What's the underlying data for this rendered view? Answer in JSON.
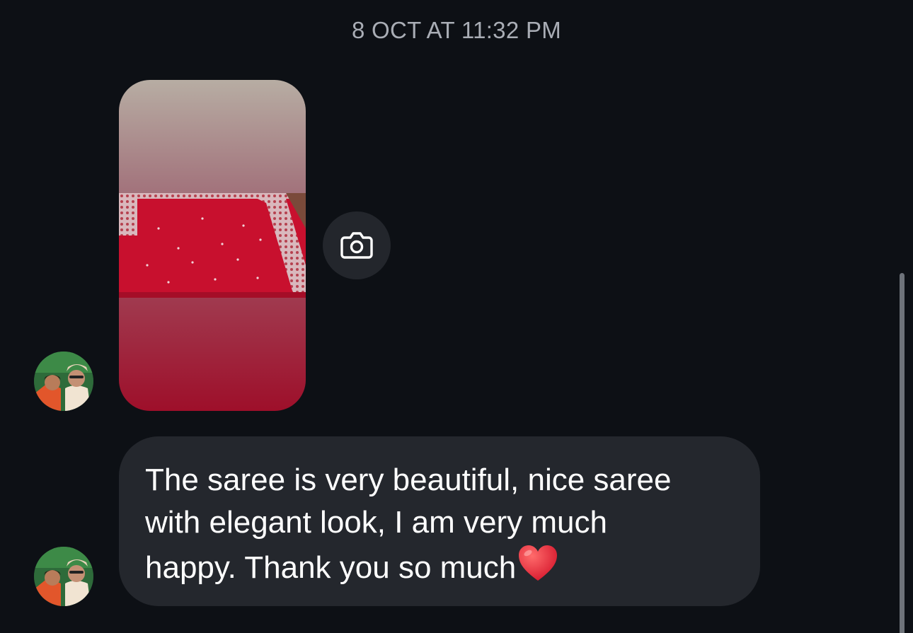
{
  "conversation": {
    "timestamp": "8 OCT AT 11:32 PM",
    "messages": [
      {
        "type": "photo",
        "description_icon": "saree-photo"
      },
      {
        "type": "text",
        "lines": [
          "The saree is very beautiful, nice saree",
          "with elegant look, I am very much",
          "happy. Thank you so much"
        ],
        "emoji": "heart-emoji"
      }
    ]
  },
  "actions": {
    "camera_icon": "camera-icon"
  },
  "colors": {
    "background": "#0d1015",
    "bubble": "#24272d",
    "timestamp_text": "#a9adb5",
    "message_text": "#ffffff",
    "saree_red": "#c8102e",
    "heart": "#e0202e"
  }
}
